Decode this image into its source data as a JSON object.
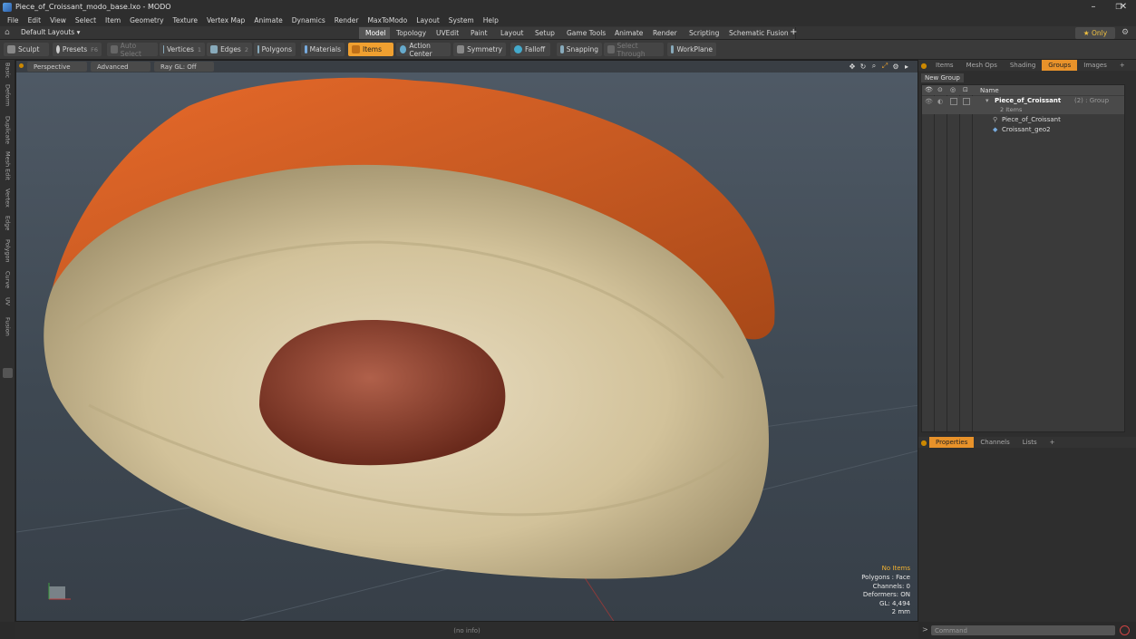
{
  "window": {
    "title": "Piece_of_Croissant_modo_base.lxo - MODO",
    "icons": [
      "app-icon",
      "minimize-icon",
      "maximize-icon",
      "close-icon"
    ]
  },
  "menu": [
    "File",
    "Edit",
    "View",
    "Select",
    "Item",
    "Geometry",
    "Texture",
    "Vertex Map",
    "Animate",
    "Dynamics",
    "Render",
    "MaxToModo",
    "Layout",
    "System",
    "Help"
  ],
  "layout": {
    "selector": "Default Layouts ▾",
    "tabs": [
      "Model",
      "Topology",
      "UVEdit",
      "Paint",
      "Layout",
      "Setup",
      "Game Tools",
      "Animate",
      "Render",
      "Scripting",
      "Schematic Fusion"
    ],
    "active_tab": "Model",
    "plus": "+",
    "only": "★  Only"
  },
  "toolbar": {
    "sculpt": "Sculpt",
    "presets": "Presets",
    "presets_key": "F6",
    "auto_select": "Auto Select",
    "vertices": "Vertices",
    "vertices_key": "1",
    "edges": "Edges",
    "edges_key": "2",
    "polygons": "Polygons",
    "materials": "Materials",
    "items": "Items",
    "action_center": "Action Center",
    "symmetry": "Symmetry",
    "falloff": "Falloff",
    "snapping": "Snapping",
    "select_through": "Select Through",
    "workplane": "WorkPlane"
  },
  "left_tabs": [
    "Basic",
    "Deform",
    "Duplicate",
    "Mesh Edit",
    "Vertex",
    "Edge",
    "Polygon",
    "Curve",
    "UV",
    "Fusion"
  ],
  "viewport": {
    "perspective": "Perspective",
    "advanced": "Advanced",
    "raygl": "Ray GL: Off",
    "stats": {
      "no_items": "No Items",
      "polygons": "Polygons : Face",
      "channels": "Channels: 0",
      "deformers": "Deformers: ON",
      "gl": "GL: 4,494",
      "size": "2 mm"
    }
  },
  "status": "(no info)",
  "right_panel": {
    "tabs": [
      "Items",
      "Mesh Ops",
      "Shading",
      "Groups",
      "Images",
      "+"
    ],
    "active_tab": "Groups",
    "new_group": "New Group",
    "name_header": "Name",
    "group_name": "Piece_of_Croissant",
    "group_suffix": "(2) : Group",
    "group_count": "2 Items",
    "children": [
      "Piece_of_Croissant",
      "Croissant_geo2"
    ]
  },
  "props_panel": {
    "tabs": [
      "Properties",
      "Channels",
      "Lists",
      "+"
    ],
    "active_tab": "Properties"
  },
  "command": {
    "placeholder": "Command"
  },
  "colors": {
    "accent": "#e8922a",
    "items_active": "#f0a030"
  }
}
